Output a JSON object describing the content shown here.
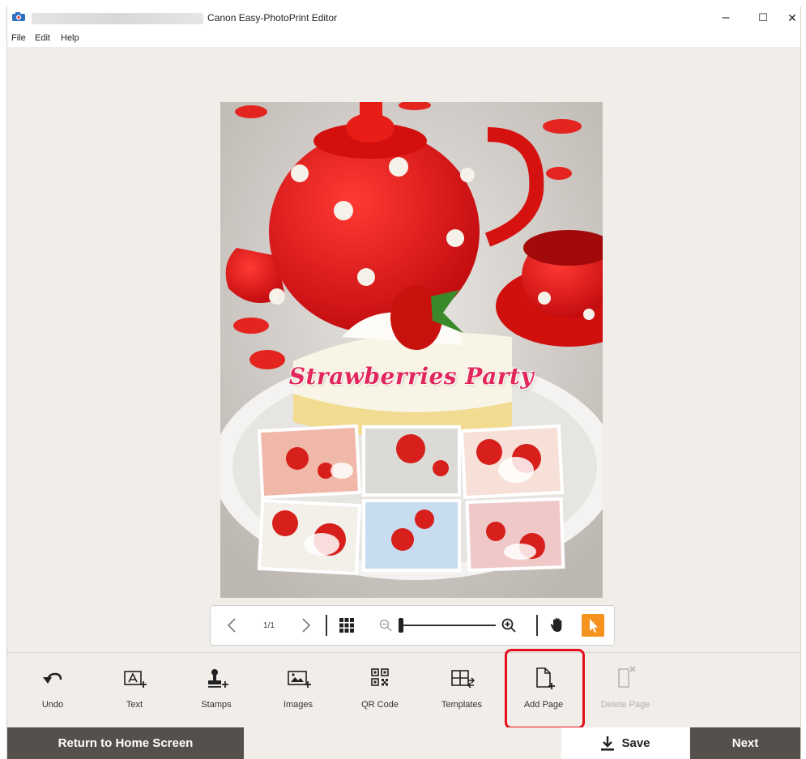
{
  "window": {
    "title": "Canon Easy-PhotoPrint Editor",
    "controls": {
      "minimize": "–",
      "maximize": "☐",
      "close": "✕"
    }
  },
  "menu": [
    "File",
    "Edit",
    "Help"
  ],
  "preview": {
    "title_text": "Strawberries Party"
  },
  "navigation": {
    "page_indicator": "1/1",
    "zoom_level": 0.02
  },
  "tools": [
    {
      "label": "Undo",
      "icon": "undo-icon",
      "enabled": true
    },
    {
      "label": "Text",
      "icon": "text-icon",
      "enabled": true
    },
    {
      "label": "Stamps",
      "icon": "stamp-icon",
      "enabled": true
    },
    {
      "label": "Images",
      "icon": "images-icon",
      "enabled": true
    },
    {
      "label": "QR Code",
      "icon": "qr-code-icon",
      "enabled": true
    },
    {
      "label": "Templates",
      "icon": "templates-icon",
      "enabled": true
    },
    {
      "label": "Add Page",
      "icon": "add-page-icon",
      "enabled": true
    },
    {
      "label": "Delete Page",
      "icon": "delete-page-icon",
      "enabled": false
    }
  ],
  "footer": {
    "home_label": "Return to Home Screen",
    "save_label": "Save",
    "next_label": "Next"
  },
  "colors": {
    "accent": "#f6921e",
    "highlight": "#e3101a",
    "footer_dark": "#55504b",
    "background": "#f1eeea"
  }
}
